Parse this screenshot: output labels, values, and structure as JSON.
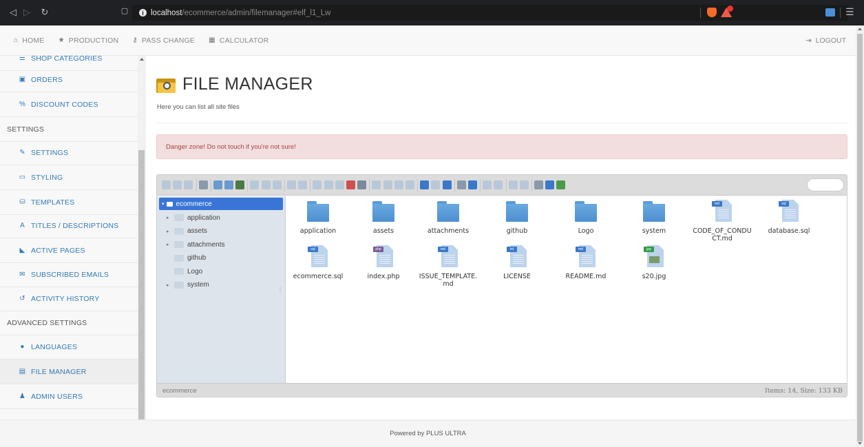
{
  "browser": {
    "url_host": "localhost",
    "url_path": "/ecommerce/admin/filemanager#elf_l1_Lw"
  },
  "topnav": {
    "items": [
      {
        "icon": "home-icon",
        "glyph": "⌂",
        "label": "HOME"
      },
      {
        "icon": "star-icon",
        "glyph": "★",
        "label": "PRODUCTION"
      },
      {
        "icon": "key-icon",
        "glyph": "⚷",
        "label": "PASS CHANGE"
      },
      {
        "icon": "calculator-icon",
        "glyph": "▦",
        "label": "CALCULATOR"
      }
    ],
    "logout": "LOGOUT"
  },
  "sidebar": {
    "items": [
      {
        "label": "SHOP CATEGORIES",
        "icon": "list-icon",
        "glyph": "☰"
      },
      {
        "label": "ORDERS",
        "icon": "money-icon",
        "glyph": "▣"
      },
      {
        "label": "DISCOUNT CODES",
        "icon": "percent-icon",
        "glyph": "%"
      },
      {
        "label": "SETTINGS",
        "header": true
      },
      {
        "label": "SETTINGS",
        "icon": "wrench-icon",
        "glyph": "✎"
      },
      {
        "label": "STYLING",
        "icon": "monitor-icon",
        "glyph": "▭"
      },
      {
        "label": "TEMPLATES",
        "icon": "binoculars-icon",
        "glyph": "⛁"
      },
      {
        "label": "TITLES / DESCRIPTIONS",
        "icon": "font-icon",
        "glyph": "A"
      },
      {
        "label": "ACTIVE PAGES",
        "icon": "bookmark-icon",
        "glyph": "◣"
      },
      {
        "label": "SUBSCRIBED EMAILS",
        "icon": "envelope-icon",
        "glyph": "✉"
      },
      {
        "label": "ACTIVITY HISTORY",
        "icon": "history-icon",
        "glyph": "↺"
      },
      {
        "label": "ADVANCED SETTINGS",
        "header": true
      },
      {
        "label": "LANGUAGES",
        "icon": "globe-icon",
        "glyph": "●"
      },
      {
        "label": "FILE MANAGER",
        "icon": "file-icon",
        "glyph": "▤",
        "active": true
      },
      {
        "label": "ADMIN USERS",
        "icon": "user-icon",
        "glyph": "♟"
      }
    ]
  },
  "main": {
    "title": "FILE MANAGER",
    "subtitle": "Here you can list all site files",
    "alert": "Danger zone! Do not touch if you're not sure!"
  },
  "elfinder": {
    "tree": {
      "root": "ecommerce",
      "children": [
        {
          "label": "application",
          "expandable": true
        },
        {
          "label": "assets",
          "expandable": true
        },
        {
          "label": "attachments",
          "expandable": true
        },
        {
          "label": "github",
          "expandable": false
        },
        {
          "label": "Logo",
          "expandable": false
        },
        {
          "label": "system",
          "expandable": true
        }
      ]
    },
    "files": [
      {
        "name": "application",
        "type": "folder"
      },
      {
        "name": "assets",
        "type": "folder"
      },
      {
        "name": "attachments",
        "type": "folder"
      },
      {
        "name": "github",
        "type": "folder"
      },
      {
        "name": "Logo",
        "type": "folder"
      },
      {
        "name": "system",
        "type": "folder"
      },
      {
        "name": "CODE_OF_CONDUCT.md",
        "type": "md",
        "badge": "md",
        "color": "#3a78c9"
      },
      {
        "name": "database.sql",
        "type": "sql",
        "badge": "sql",
        "color": "#3a78c9"
      },
      {
        "name": "ecommerce.sql",
        "type": "sql",
        "badge": "sql",
        "color": "#3a78c9"
      },
      {
        "name": "index.php",
        "type": "php",
        "badge": "php",
        "color": "#7a5a9a"
      },
      {
        "name": "ISSUE_TEMPLATE.md",
        "type": "md",
        "badge": "md",
        "color": "#3a78c9"
      },
      {
        "name": "LICENSE",
        "type": "txt",
        "badge": "txt",
        "color": "#3a78c9"
      },
      {
        "name": "README.md",
        "type": "md",
        "badge": "md",
        "color": "#3a78c9"
      },
      {
        "name": "s20.jpg",
        "type": "jpg",
        "badge": "jpg",
        "color": "#2e9a4a"
      }
    ],
    "status_left": "ecommerce",
    "status_right": "Items: 14, Size: 133 KB"
  },
  "footer": "Powered by PLUS ULTRA"
}
